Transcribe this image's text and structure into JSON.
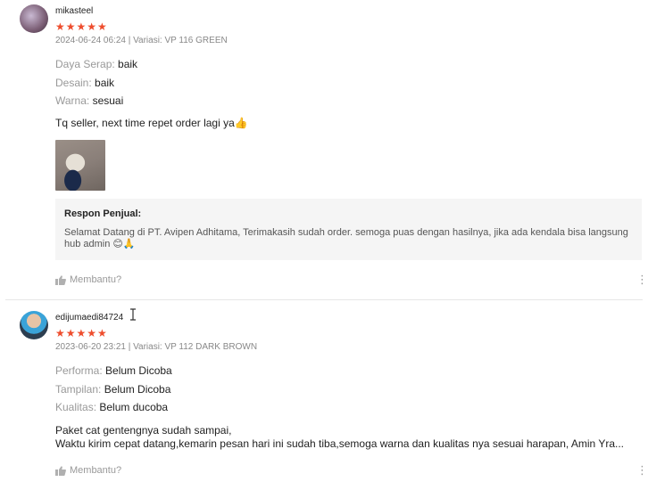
{
  "reviews": [
    {
      "username": "mikasteel",
      "stars": "★★★★★",
      "meta": "2024-06-24 06:24 | Variasi: VP 116 GREEN",
      "attributes": [
        {
          "key": "Daya Serap:",
          "value": "baik"
        },
        {
          "key": "Desain:",
          "value": "baik"
        },
        {
          "key": "Warna:",
          "value": "sesuai"
        }
      ],
      "comment": "Tq seller, next time repet order lagi ya👍",
      "seller_response": {
        "title": "Respon Penjual:",
        "text": "Selamat Datang di PT. Avipen Adhitama, Terimakasih sudah order. semoga puas dengan hasilnya, jika ada kendala bisa langsung hub admin 😊🙏"
      },
      "helpful_label": "Membantu?"
    },
    {
      "username": "edijumaedi84724",
      "stars": "★★★★★",
      "meta": "2023-06-20 23:21 | Variasi: VP 112 DARK BROWN",
      "attributes": [
        {
          "key": "Performa:",
          "value": "Belum Dicoba"
        },
        {
          "key": "Tampilan:",
          "value": "Belum Dicoba"
        },
        {
          "key": "Kualitas:",
          "value": "Belum ducoba"
        }
      ],
      "comment_lines": [
        "Paket cat gentengnya sudah sampai,",
        "Waktu kirim cepat datang,kemarin pesan hari ini sudah tiba,semoga warna dan kualitas nya sesuai harapan, Amin Yra..."
      ],
      "helpful_label": "Membantu?"
    }
  ],
  "colors": {
    "star": "#ee4d2d",
    "muted": "#999999",
    "response_bg": "#f5f5f5"
  },
  "icons": {
    "helpful": "thumbs-up-icon",
    "more": "more-vertical-icon",
    "cursor": "text-cursor-icon"
  }
}
